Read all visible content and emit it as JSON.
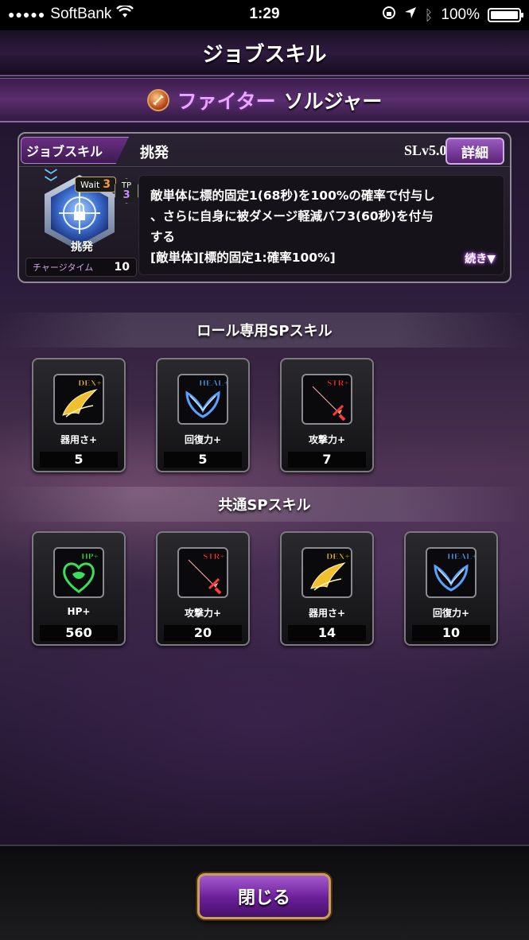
{
  "status_bar": {
    "carrier": "SoftBank",
    "time": "1:29",
    "battery": "100%",
    "battery_level": 1.0
  },
  "header": {
    "title": "ジョブスキル"
  },
  "job": {
    "class_name": "ファイター",
    "role_name": "ソルジャー",
    "icon": "fighter-emblem-icon"
  },
  "job_skill": {
    "tab_label": "ジョブスキル",
    "name": "挑発",
    "level": "SLv5.0",
    "detail_label": "詳細",
    "emblem_name": "挑発",
    "wait_label": "Wait",
    "wait_value": "3",
    "tp_label": "TP",
    "tp_value": "3",
    "charge_label": "チャージタイム",
    "charge_value": "10",
    "description_lines": [
      "敵単体に標的固定1(68秒)を100%の確率で付与し",
      "、さらに自身に被ダメージ軽減バフ3(60秒)を付与",
      "する",
      "[敵単体][標的固定1:確率100%]"
    ],
    "more_label": "続き▼"
  },
  "role_sp": {
    "title": "ロール専用SPスキル",
    "cards": [
      {
        "icon": "dex-wing-icon",
        "badge": "DEX+",
        "label": "器用さ+",
        "value": "5",
        "color": "#f0c030"
      },
      {
        "icon": "heal-wing-icon",
        "badge": "HEAL+",
        "label": "回復力+",
        "value": "5",
        "color": "#5aa0ff"
      },
      {
        "icon": "str-sword-icon",
        "badge": "STR+",
        "label": "攻撃力+",
        "value": "7",
        "color": "#ff3a3a"
      }
    ]
  },
  "common_sp": {
    "title": "共通SPスキル",
    "cards": [
      {
        "icon": "hp-heart-icon",
        "badge": "HP+",
        "label": "HP+",
        "value": "560",
        "color": "#3ae05a"
      },
      {
        "icon": "str-sword-icon",
        "badge": "STR+",
        "label": "攻撃力+",
        "value": "20",
        "color": "#ff3a3a"
      },
      {
        "icon": "dex-wing-icon",
        "badge": "DEX+",
        "label": "器用さ+",
        "value": "14",
        "color": "#f0c030"
      },
      {
        "icon": "heal-wing-icon",
        "badge": "HEAL+",
        "label": "回復力+",
        "value": "10",
        "color": "#5aa0ff"
      }
    ]
  },
  "footer": {
    "close_label": "閉じる"
  }
}
